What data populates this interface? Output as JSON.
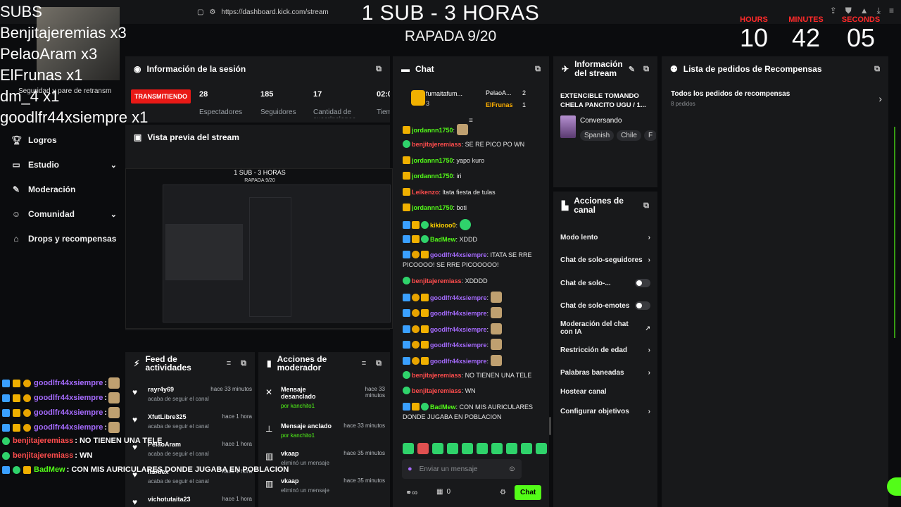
{
  "browser": {
    "url": "https://dashboard.kick.com/stream"
  },
  "overlay": {
    "title": "1 SUB - 3 HORAS",
    "subtitle": "RAPADA 9/20",
    "subs_header": "SUBS",
    "subs": [
      "Benjitajeremias x3",
      "PelaoAram x3",
      "ElFrunas x1",
      "dm_4 x1",
      "goodlfr44xsiempre x1"
    ],
    "timer": {
      "hours_label": "HOURS",
      "minutes_label": "MINUTES",
      "seconds_label": "SECONDS",
      "hours": "10",
      "minutes": "42",
      "seconds": "05"
    }
  },
  "sidebar": {
    "partial_text": "Seguridad y pare de retransm",
    "items": [
      {
        "label": "Logros",
        "icon": "trophy-icon"
      },
      {
        "label": "Estudio",
        "icon": "studio-icon",
        "chevron": "⌄"
      },
      {
        "label": "Moderación",
        "icon": "wrench-icon"
      },
      {
        "label": "Comunidad",
        "icon": "community-icon",
        "chevron": "⌄"
      },
      {
        "label": "Drops y recompensas",
        "icon": "gift-icon"
      }
    ]
  },
  "session": {
    "title": "Información de la sesión",
    "live": "TRANSMITIENDO",
    "stats": [
      {
        "value": "28",
        "label": "Espectadores"
      },
      {
        "value": "185",
        "label": "Seguidores"
      },
      {
        "value": "17",
        "label": "Cantidad de suscripciones"
      },
      {
        "value": "02:0",
        "label": "Tiem"
      }
    ]
  },
  "preview": {
    "title": "Vista previa del stream"
  },
  "chat": {
    "title": "Chat",
    "top": {
      "user1": "fumaitafum...",
      "count1": "3",
      "user2": "PelaoA...",
      "count2": "2",
      "user3": "ElFrunas",
      "count3": "1"
    },
    "messages": [
      {
        "user": "jordannn1750",
        "text": ""
      },
      {
        "user": "benjitajeremiass",
        "text": "SE RE PICO PO WN"
      },
      {
        "user": "jordannn1750",
        "text": "yapo kuro"
      },
      {
        "user": "jordannn1750",
        "text": "iri"
      },
      {
        "user": "Leikenzo",
        "text": "ltata fiesta de tulas"
      },
      {
        "user": "jordannn1750",
        "text": "boti"
      },
      {
        "user": "kikiooo0",
        "text": ""
      },
      {
        "user": "BadMew",
        "text": "XDDD"
      },
      {
        "user": "goodlfr44xsiempre",
        "text": "ITATA SE RRE PICOOOO! SE RRE PICOOOOO!"
      },
      {
        "user": "benjitajeremiass",
        "text": "XDDDD"
      },
      {
        "user": "goodlfr44xsiempre",
        "text": ""
      },
      {
        "user": "goodlfr44xsiempre",
        "text": ""
      },
      {
        "user": "goodlfr44xsiempre",
        "text": ""
      },
      {
        "user": "goodlfr44xsiempre",
        "text": ""
      },
      {
        "user": "goodlfr44xsiempre",
        "text": ""
      },
      {
        "user": "benjitajeremiass",
        "text": "NO TIENEN UNA TELE"
      },
      {
        "user": "benjitajeremiass",
        "text": "WN"
      },
      {
        "user": "BadMew",
        "text": "CON MIS AURICULARES DONDE JUGABA EN POBLACION"
      }
    ],
    "input_placeholder": "Enviar un mensaje",
    "send_label": "Chat",
    "footer_count": "0"
  },
  "stream_info": {
    "title": "Información del stream",
    "stream_title": "EXTENCIBLE TOMANDO CHELA PANCITO UGU / 1...",
    "category": "Conversando",
    "tags": [
      "Spanish",
      "Chile",
      "F"
    ]
  },
  "rewards": {
    "title": "Lista de pedidos de Recompensas",
    "all": "Todos los pedidos de recompensas",
    "pending": "8 pedidos"
  },
  "channel_actions": {
    "title": "Acciones de canal",
    "items": [
      {
        "label": "Modo lento",
        "kind": "chevron"
      },
      {
        "label": "Chat de solo-seguidores",
        "kind": "chevron"
      },
      {
        "label": "Chat de solo-...",
        "kind": "toggle"
      },
      {
        "label": "Chat de solo-emotes",
        "kind": "toggle"
      },
      {
        "label": "Moderación del chat con IA",
        "kind": "external"
      },
      {
        "label": "Restricción de edad",
        "kind": "chevron"
      },
      {
        "label": "Palabras baneadas",
        "kind": "chevron"
      },
      {
        "label": "Hostear canal",
        "kind": "none"
      },
      {
        "label": "Configurar objetivos",
        "kind": "chevron"
      }
    ]
  },
  "feed": {
    "title": "Feed de actividades",
    "items": [
      {
        "name": "rayr4y69",
        "desc": "acaba de seguir el canal",
        "time": "hace 33 minutos"
      },
      {
        "name": "XfutLibre325",
        "desc": "acaba de seguir el canal",
        "time": "hace 1 hora"
      },
      {
        "name": "PelaoAram",
        "desc": "acaba de seguir el canal",
        "time": "hace 1 hora"
      },
      {
        "name": "ItsAlex",
        "desc": "acaba de seguir el canal",
        "time": "hace 1 hora"
      },
      {
        "name": "vichotutaita23",
        "desc": "",
        "time": "hace 1 hora"
      }
    ]
  },
  "mod_actions": {
    "title": "Acciones de moderador",
    "items": [
      {
        "action": "Mensaje desanclado",
        "by": "por kanchito1",
        "time": "hace 33 minutos"
      },
      {
        "action": "Mensaje anclado",
        "by": "por kanchito1",
        "time": "hace 33 minutos"
      },
      {
        "action": "vkaap",
        "by": "eliminó un mensaje",
        "time": "hace 35 minutos"
      },
      {
        "action": "vkaap",
        "by": "eliminó un mensaje",
        "time": "hace 35 minutos"
      }
    ]
  },
  "overlay_chat": [
    {
      "user": "goodlfr44xsiempre",
      "text": " :"
    },
    {
      "user": "goodlfr44xsiempre",
      "text": " :"
    },
    {
      "user": "goodlfr44xsiempre",
      "text": " :"
    },
    {
      "user": "goodlfr44xsiempre",
      "text": " :"
    },
    {
      "user": "benjitajeremiass",
      "text": " : NO TIENEN UNA TELE"
    },
    {
      "user": "benjitajeremiass",
      "text": " : WN"
    },
    {
      "user": "BadMew",
      "text": " : CON MIS AURICULARES DONDE JUGABA EN POBLACION"
    }
  ],
  "colors": {
    "accent": "#53fc18",
    "live": "#e91916",
    "timer_label": "#ff2a2a",
    "sub_user": "#a66bff"
  }
}
